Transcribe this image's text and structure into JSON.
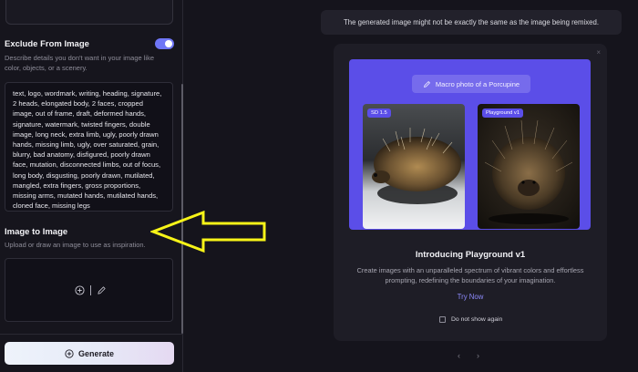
{
  "sidebar": {
    "exclude": {
      "title": "Exclude From Image",
      "description": "Describe details you don't want in your image like color, objects, or a scenery.",
      "toggle_on": true,
      "negative_prompt": "text, logo, wordmark, writing, heading, signature, 2 heads, elongated body, 2 faces, cropped image, out of frame, draft, deformed hands, signature, watermark, twisted fingers, double image, long neck, extra limb, ugly, poorly drawn hands, missing limb, ugly, over saturated, grain, blurry, bad anatomy, disfigured, poorly drawn face, mutation, disconnected limbs, out of focus, long body, disgusting, poorly drawn, mutilated, mangled, extra fingers, gross proportions, missing arms, mutated hands, mutilated hands, cloned face, missing legs"
    },
    "image_to_image": {
      "title": "Image to Image",
      "description": "Upload or draw an image to use as inspiration."
    },
    "generate_label": "Generate"
  },
  "main": {
    "banner_text": "The generated image might not be exactly the same as the image being remixed.",
    "modal": {
      "close": "×",
      "prompt": "Macro photo of a Porcupine",
      "card_a_badge": "SD 1.5",
      "card_b_badge": "Playground v1",
      "title": "Introducing Playground v1",
      "description": "Create images with an unparalleled spectrum of vibrant colors and effortless prompting, redefining the boundaries of your imagination.",
      "try_now": "Try Now",
      "dont_show": "Do not show again"
    },
    "pager": {
      "prev": "‹",
      "next": "›"
    }
  },
  "colors": {
    "accent": "#6f76f6",
    "hero_bg": "#5b4ee8",
    "annotation_arrow": "#f7f418"
  }
}
